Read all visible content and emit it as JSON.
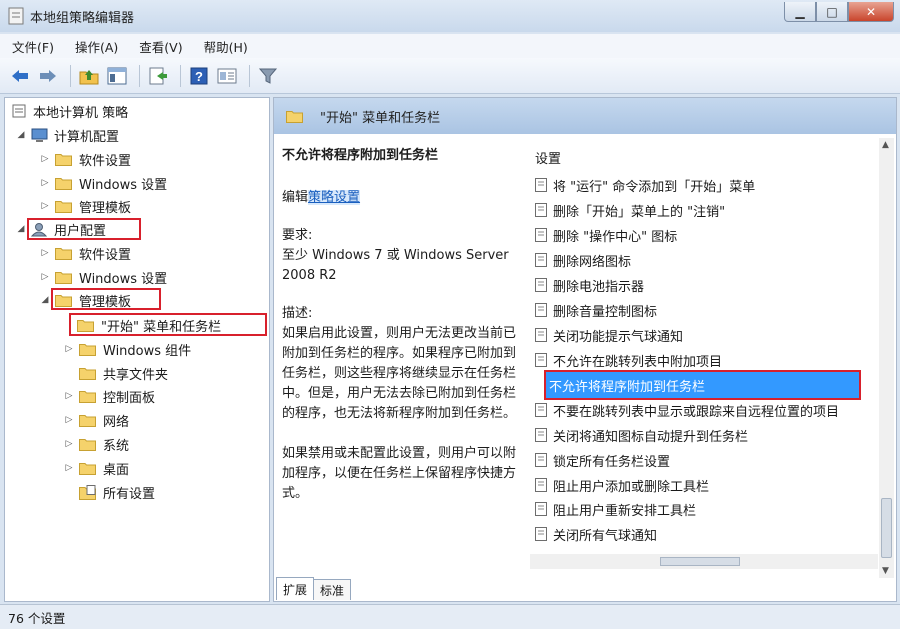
{
  "window": {
    "title": "本地组策略编辑器",
    "min": "▁",
    "max": "□",
    "close": "✕"
  },
  "menu": [
    "文件(F)",
    "操作(A)",
    "查看(V)",
    "帮助(H)"
  ],
  "toolbar": {
    "icons": [
      "back-arrow-icon",
      "forward-arrow-icon",
      "up-folder-icon",
      "show-hide-tree-icon",
      "export-list-icon",
      "help-icon",
      "properties-icon",
      "filter-icon"
    ]
  },
  "tree": {
    "root": "本地计算机 策略",
    "computer_config": "计算机配置",
    "computer_software": "软件设置",
    "computer_windows": "Windows 设置",
    "computer_admin": "管理模板",
    "user_config": "用户配置",
    "user_software": "软件设置",
    "user_windows": "Windows 设置",
    "user_admin": "管理模板",
    "start_menu": "\"开始\" 菜单和任务栏",
    "windows_components": "Windows 组件",
    "shared_folders": "共享文件夹",
    "control_panel": "控制面板",
    "network": "网络",
    "system": "系统",
    "desktop": "桌面",
    "all_settings": "所有设置"
  },
  "right": {
    "header_title": "\"开始\" 菜单和任务栏",
    "desc_title": "不允许将程序附加到任务栏",
    "edit_prefix": "编辑",
    "edit_link": "策略设置",
    "req_label": "要求:",
    "req_text": "至少 Windows 7 或 Windows Server 2008 R2",
    "desc_label": "描述:",
    "desc_text": "如果启用此设置，则用户无法更改当前已附加到任务栏的程序。如果程序已附加到任务栏，则这些程序将继续显示在任务栏中。但是，用户无法去除已附加到任务栏的程序，也无法将新程序附加到任务栏。",
    "desc_text2": "如果禁用或未配置此设置，则用户可以附加程序，以便在任务栏上保留程序快捷方式。",
    "settings_header": "设置",
    "settings": [
      "将 \"运行\" 命令添加到「开始」菜单",
      "删除「开始」菜单上的 \"注销\"",
      "删除 \"操作中心\" 图标",
      "删除网络图标",
      "删除电池指示器",
      "删除音量控制图标",
      "关闭功能提示气球通知",
      "不允许在跳转列表中附加项目",
      "不允许将程序附加到任务栏",
      "不要在跳转列表中显示或跟踪来自远程位置的项目",
      "关闭将通知图标自动提升到任务栏",
      "锁定所有任务栏设置",
      "阻止用户添加或删除工具栏",
      "阻止用户重新安排工具栏",
      "关闭所有气球通知"
    ],
    "tabs": [
      "扩展",
      "标准"
    ]
  },
  "status": {
    "text": "76 个设置"
  },
  "colors": {
    "selected": "#3399ff",
    "highlight_box": "#d8202c"
  }
}
